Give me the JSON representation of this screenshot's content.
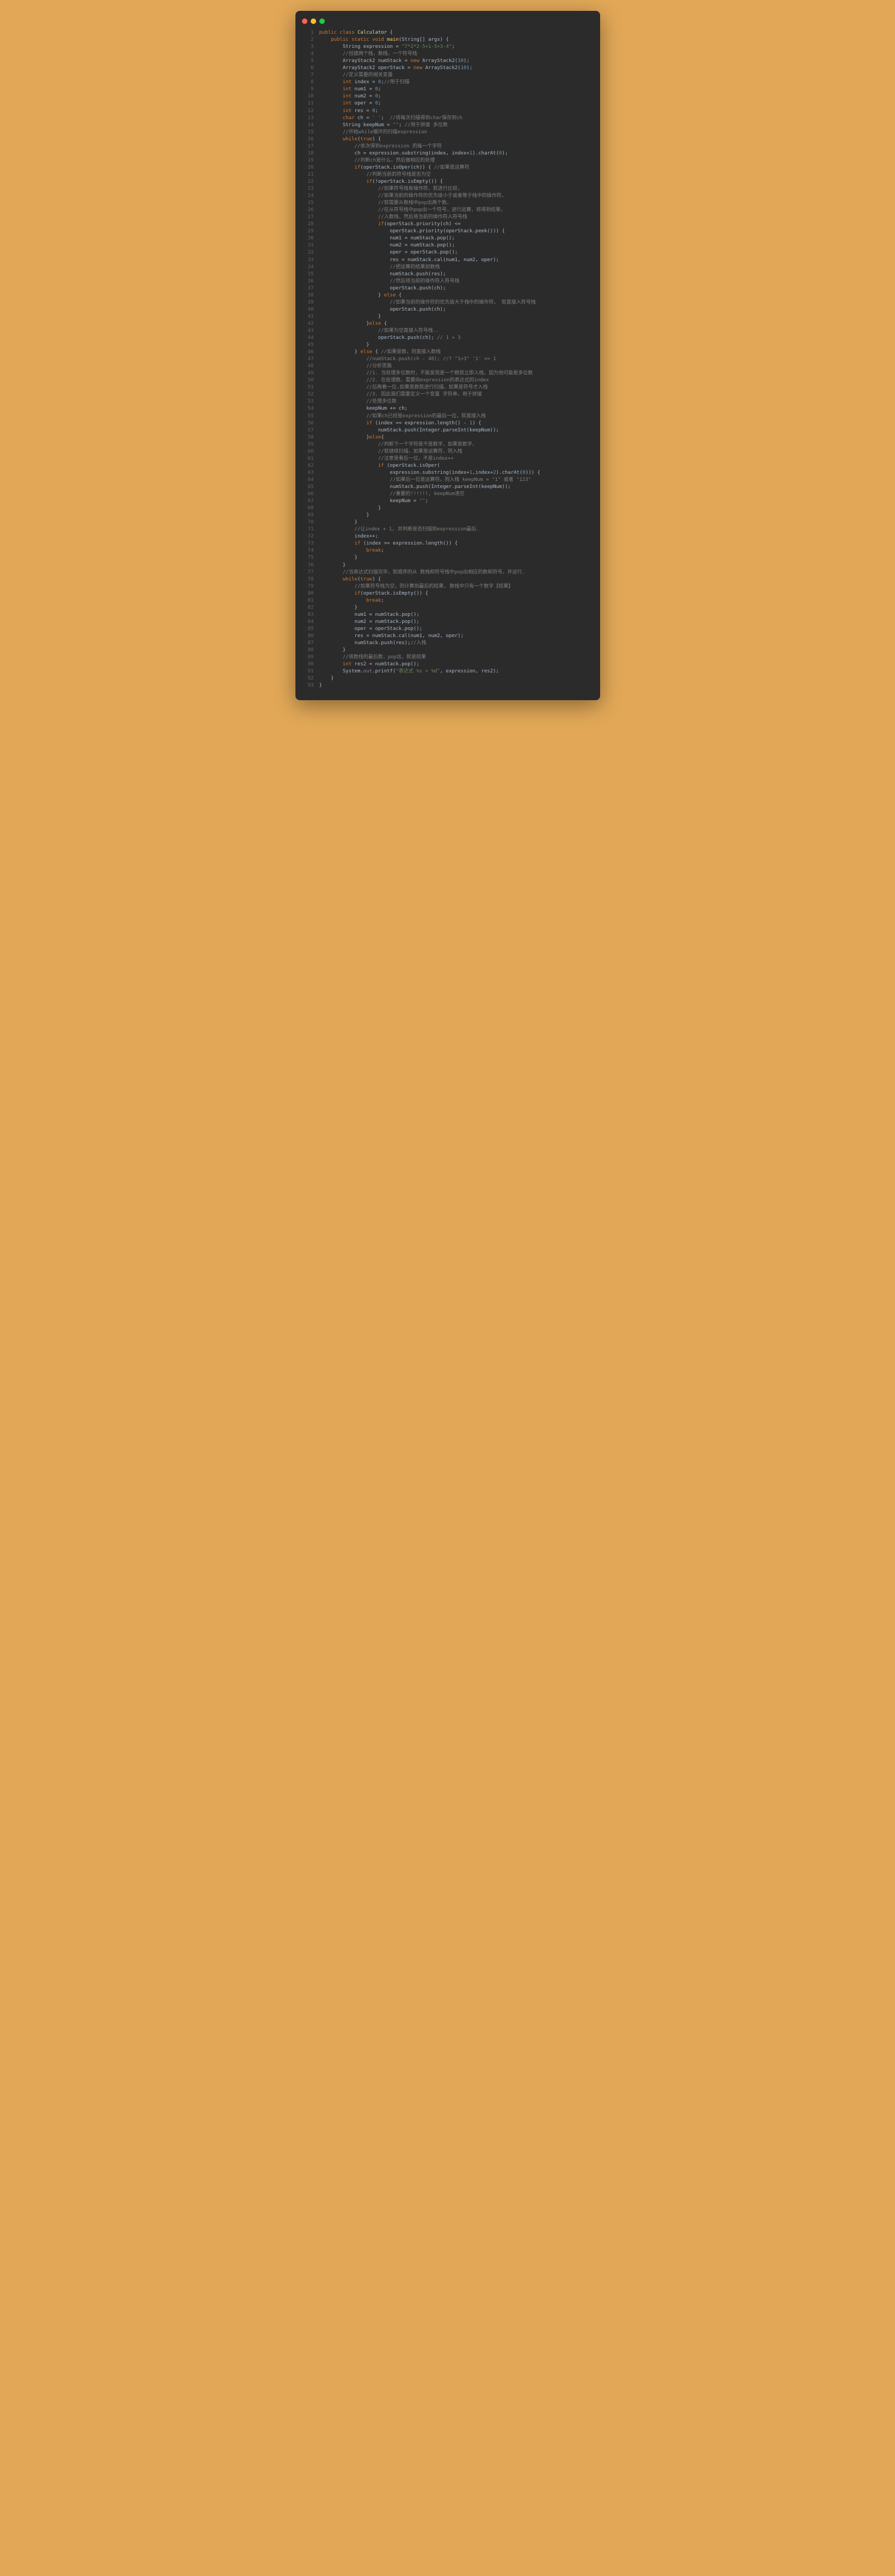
{
  "traffic_light": {
    "red": "#ff5f56",
    "yellow": "#ffbd2e",
    "green": "#27c93f"
  },
  "code": [
    [
      {
        "c": "kw",
        "t": "public class "
      },
      {
        "c": "cls",
        "t": "Calculator"
      },
      {
        "t": " {"
      }
    ],
    [
      {
        "t": "    "
      },
      {
        "c": "kw",
        "t": "public static void "
      },
      {
        "c": "meth",
        "t": "main"
      },
      {
        "t": "(String[] args) {"
      }
    ],
    [
      {
        "t": "        String expression = "
      },
      {
        "c": "str",
        "t": "\"7*2*2-5+1-5+3-4\""
      },
      {
        "t": ";"
      }
    ],
    [
      {
        "t": "        "
      },
      {
        "c": "com",
        "t": "//创建两个栈，数栈，一个符号栈"
      }
    ],
    [
      {
        "t": "        ArrayStack2 numStack = "
      },
      {
        "c": "kw",
        "t": "new "
      },
      {
        "t": "ArrayStack2("
      },
      {
        "c": "num",
        "t": "10"
      },
      {
        "t": ");"
      }
    ],
    [
      {
        "t": "        ArrayStack2 operStack = "
      },
      {
        "c": "kw",
        "t": "new "
      },
      {
        "t": "ArrayStack2("
      },
      {
        "c": "num",
        "t": "10"
      },
      {
        "t": ");"
      }
    ],
    [
      {
        "t": "        "
      },
      {
        "c": "com",
        "t": "//定义需要的相关变量"
      }
    ],
    [
      {
        "t": "        "
      },
      {
        "c": "kw",
        "t": "int "
      },
      {
        "t": "index = "
      },
      {
        "c": "num",
        "t": "0"
      },
      {
        "t": ";"
      },
      {
        "c": "com",
        "t": "//用于扫描"
      }
    ],
    [
      {
        "t": "        "
      },
      {
        "c": "kw",
        "t": "int "
      },
      {
        "t": "num1 = "
      },
      {
        "c": "num",
        "t": "0"
      },
      {
        "t": ";"
      }
    ],
    [
      {
        "t": "        "
      },
      {
        "c": "kw",
        "t": "int "
      },
      {
        "t": "num2 = "
      },
      {
        "c": "num",
        "t": "0"
      },
      {
        "t": ";"
      }
    ],
    [
      {
        "t": "        "
      },
      {
        "c": "kw",
        "t": "int "
      },
      {
        "t": "oper = "
      },
      {
        "c": "num",
        "t": "0"
      },
      {
        "t": ";"
      }
    ],
    [
      {
        "t": "        "
      },
      {
        "c": "kw",
        "t": "int "
      },
      {
        "t": "res = "
      },
      {
        "c": "num",
        "t": "0"
      },
      {
        "t": ";"
      }
    ],
    [
      {
        "t": "        "
      },
      {
        "c": "kw",
        "t": "char "
      },
      {
        "t": "ch = "
      },
      {
        "c": "str",
        "t": "' '"
      },
      {
        "t": ";  "
      },
      {
        "c": "com",
        "t": "//将每次扫描得到char保存到ch"
      }
    ],
    [
      {
        "t": "        String keepNum = "
      },
      {
        "c": "str",
        "t": "\"\""
      },
      {
        "t": "; "
      },
      {
        "c": "com",
        "t": "//用于拼接 多位数"
      }
    ],
    [
      {
        "t": "        "
      },
      {
        "c": "com",
        "t": "//开始while循环的扫描expression"
      }
    ],
    [
      {
        "t": "        "
      },
      {
        "c": "kw",
        "t": "while"
      },
      {
        "t": "("
      },
      {
        "c": "kw",
        "t": "true"
      },
      {
        "t": ") {"
      }
    ],
    [
      {
        "t": "            "
      },
      {
        "c": "com",
        "t": "//依次得到expression 的每一个字符"
      }
    ],
    [
      {
        "t": "            ch = expression.substring(index, index+"
      },
      {
        "c": "num",
        "t": "1"
      },
      {
        "t": ").charAt("
      },
      {
        "c": "num",
        "t": "0"
      },
      {
        "t": ");"
      }
    ],
    [
      {
        "t": "            "
      },
      {
        "c": "com",
        "t": "//判断ch是什么，然后做相应的处理"
      }
    ],
    [
      {
        "t": "            "
      },
      {
        "c": "kw",
        "t": "if"
      },
      {
        "t": "(operStack.isOper(ch)) { "
      },
      {
        "c": "com",
        "t": "//如果是运算符"
      }
    ],
    [
      {
        "t": "                "
      },
      {
        "c": "com",
        "t": "//判断当前的符号栈是否为空"
      }
    ],
    [
      {
        "t": "                "
      },
      {
        "c": "kw",
        "t": "if"
      },
      {
        "t": "(!operStack.isEmpty()) {"
      }
    ],
    [
      {
        "t": "                    "
      },
      {
        "c": "com",
        "t": "//如果符号栈有操作符，就进行比较，"
      }
    ],
    [
      {
        "t": "                    "
      },
      {
        "c": "com",
        "t": "//如果当前的操作符的优先级小于或者等于栈中的操作符，"
      }
    ],
    [
      {
        "t": "                    "
      },
      {
        "c": "com",
        "t": "//就需要从数栈中pop出两个数，"
      }
    ],
    [
      {
        "t": "                    "
      },
      {
        "c": "com",
        "t": "//在从符号栈中pop出一个符号，进行运算，将得到结果，"
      }
    ],
    [
      {
        "t": "                    "
      },
      {
        "c": "com",
        "t": "//入数栈，然后将当前的操作符入符号栈"
      }
    ],
    [
      {
        "t": "                    "
      },
      {
        "c": "kw",
        "t": "if"
      },
      {
        "t": "(operStack.priority(ch) <="
      }
    ],
    [
      {
        "t": "                        operStack.priority(operStack.peek())) {"
      }
    ],
    [
      {
        "t": "                        num1 = numStack.pop();"
      }
    ],
    [
      {
        "t": "                        num2 = numStack.pop();"
      }
    ],
    [
      {
        "t": "                        oper = operStack.pop();"
      }
    ],
    [
      {
        "t": "                        res = numStack.cal(num1, num2, oper);"
      }
    ],
    [
      {
        "t": "                        "
      },
      {
        "c": "com",
        "t": "//把运算的结果如数栈"
      }
    ],
    [
      {
        "t": "                        numStack.push(res);"
      }
    ],
    [
      {
        "t": "                        "
      },
      {
        "c": "com",
        "t": "//然后将当前的操作符入符号栈"
      }
    ],
    [
      {
        "t": "                        operStack.push(ch);"
      }
    ],
    [
      {
        "t": "                    } "
      },
      {
        "c": "kw",
        "t": "else "
      },
      {
        "t": "{"
      }
    ],
    [
      {
        "t": "                        "
      },
      {
        "c": "com",
        "t": "//如果当前的操作符的优先级大于栈中的操作符， 就直接入符号栈"
      }
    ],
    [
      {
        "t": "                        operStack.push(ch);"
      }
    ],
    [
      {
        "t": "                    }"
      }
    ],
    [
      {
        "t": "                }"
      },
      {
        "c": "kw",
        "t": "else "
      },
      {
        "t": "{"
      }
    ],
    [
      {
        "t": "                    "
      },
      {
        "c": "com",
        "t": "//如果为空直接入符号栈.."
      }
    ],
    [
      {
        "t": "                    operStack.push(ch); "
      },
      {
        "c": "com",
        "t": "// 1 + 3"
      }
    ],
    [
      {
        "t": "                }"
      }
    ],
    [
      {
        "t": "            } "
      },
      {
        "c": "kw",
        "t": "else "
      },
      {
        "t": "{ "
      },
      {
        "c": "com",
        "t": "//如果是数，则直接入数栈"
      }
    ],
    [
      {
        "t": "                "
      },
      {
        "c": "com",
        "t": "//numStack.push(ch - 48); //? \"1+3\" '1' => 1"
      }
    ],
    [
      {
        "t": "                "
      },
      {
        "c": "com",
        "t": "//分析思路"
      }
    ],
    [
      {
        "t": "                "
      },
      {
        "c": "com",
        "t": "//1. 当处理多位数时，不能发现是一个数就立即入栈，因为他可能是多位数"
      }
    ],
    [
      {
        "t": "                "
      },
      {
        "c": "com",
        "t": "//2. 在处理数，需要向expression的表达式的index"
      }
    ],
    [
      {
        "t": "                "
      },
      {
        "c": "com",
        "t": "//后再看一位,如果是数就进行扫描，如果是符号才入栈"
      }
    ],
    [
      {
        "t": "                "
      },
      {
        "c": "com",
        "t": "//3. 因此我们需要定义一个变量 字符串，用于拼接"
      }
    ],
    [
      {
        "t": "                "
      },
      {
        "c": "com",
        "t": "//处理多位数"
      }
    ],
    [
      {
        "t": "                keepNum += ch;"
      }
    ],
    [
      {
        "t": "                "
      },
      {
        "c": "com",
        "t": "//如果ch已经是expression的最后一位，就直接入栈"
      }
    ],
    [
      {
        "t": "                "
      },
      {
        "c": "kw",
        "t": "if "
      },
      {
        "t": "(index == expression.length() - "
      },
      {
        "c": "num",
        "t": "1"
      },
      {
        "t": ") {"
      }
    ],
    [
      {
        "t": "                    numStack.push(Integer.parseInt(keepNum));"
      }
    ],
    [
      {
        "t": "                }"
      },
      {
        "c": "kw",
        "t": "else"
      },
      {
        "t": "{"
      }
    ],
    [
      {
        "t": "                    "
      },
      {
        "c": "com",
        "t": "//判断下一个字符是不是数字，如果是数字，"
      }
    ],
    [
      {
        "t": "                    "
      },
      {
        "c": "com",
        "t": "//就继续扫描，如果是运算符，则入栈"
      }
    ],
    [
      {
        "t": "                    "
      },
      {
        "c": "com",
        "t": "//注意是看后一位，不是index++"
      }
    ],
    [
      {
        "t": "                    "
      },
      {
        "c": "kw",
        "t": "if "
      },
      {
        "t": "(operStack.isOper("
      }
    ],
    [
      {
        "t": "                        expression.substring(index+"
      },
      {
        "c": "num",
        "t": "1"
      },
      {
        "t": ",index+"
      },
      {
        "c": "num",
        "t": "2"
      },
      {
        "t": ").charAt("
      },
      {
        "c": "num",
        "t": "0"
      },
      {
        "t": "))) {"
      }
    ],
    [
      {
        "t": "                        "
      },
      {
        "c": "com",
        "t": "//如果后一位是运算符，则入栈 keepNum = \"1\" 或者 \"123\""
      }
    ],
    [
      {
        "t": "                        numStack.push(Integer.parseInt(keepNum));"
      }
    ],
    [
      {
        "t": "                        "
      },
      {
        "c": "com",
        "t": "//重要的!!!!!!, keepNum清空"
      }
    ],
    [
      {
        "t": "                        keepNum = "
      },
      {
        "c": "str",
        "t": "\"\""
      },
      {
        "t": ";"
      }
    ],
    [
      {
        "t": "                    }"
      }
    ],
    [
      {
        "t": "                }"
      }
    ],
    [
      {
        "t": "            }"
      }
    ],
    [
      {
        "t": "            "
      },
      {
        "c": "com",
        "t": "//让index + 1, 并判断是否扫描到expression最后."
      }
    ],
    [
      {
        "t": "            index++;"
      }
    ],
    [
      {
        "t": "            "
      },
      {
        "c": "kw",
        "t": "if "
      },
      {
        "t": "(index >= expression.length()) {"
      }
    ],
    [
      {
        "t": "                "
      },
      {
        "c": "kw",
        "t": "break"
      },
      {
        "t": ";"
      }
    ],
    [
      {
        "t": "            }"
      }
    ],
    [
      {
        "t": "        }"
      }
    ],
    [
      {
        "t": "        "
      },
      {
        "c": "com",
        "t": "//当表达式扫描完毕，就顺序的从 数栈和符号栈中pop出相应的数和符号，并运行."
      }
    ],
    [
      {
        "t": "        "
      },
      {
        "c": "kw",
        "t": "while"
      },
      {
        "t": "("
      },
      {
        "c": "kw",
        "t": "true"
      },
      {
        "t": ") {"
      }
    ],
    [
      {
        "t": "            "
      },
      {
        "c": "com",
        "t": "//如果符号栈为空，则计算到最后的结果, 数栈中只有一个数字【结果】"
      }
    ],
    [
      {
        "t": "            "
      },
      {
        "c": "kw",
        "t": "if"
      },
      {
        "t": "(operStack.isEmpty()) {"
      }
    ],
    [
      {
        "t": "                "
      },
      {
        "c": "kw",
        "t": "break"
      },
      {
        "t": ";"
      }
    ],
    [
      {
        "t": "            }"
      }
    ],
    [
      {
        "t": "            num1 = numStack.pop();"
      }
    ],
    [
      {
        "t": "            num2 = numStack.pop();"
      }
    ],
    [
      {
        "t": "            oper = operStack.pop();"
      }
    ],
    [
      {
        "t": "            res = numStack.cal(num1, num2, oper);"
      }
    ],
    [
      {
        "t": "            numStack.push(res);"
      },
      {
        "c": "com",
        "t": "//入栈"
      }
    ],
    [
      {
        "t": "        }"
      }
    ],
    [
      {
        "t": "        "
      },
      {
        "c": "com",
        "t": "//将数栈的最后数，pop出，就是结果"
      }
    ],
    [
      {
        "t": "        "
      },
      {
        "c": "kw",
        "t": "int "
      },
      {
        "t": "res2 = numStack.pop();"
      }
    ],
    [
      {
        "t": "        System."
      },
      {
        "c": "fld",
        "t": "out"
      },
      {
        "t": ".printf("
      },
      {
        "c": "str",
        "t": "\"表达式 %s = %d\""
      },
      {
        "t": ", expression, res2);"
      }
    ],
    [
      {
        "t": "    }"
      }
    ],
    [
      {
        "t": "}"
      }
    ]
  ]
}
